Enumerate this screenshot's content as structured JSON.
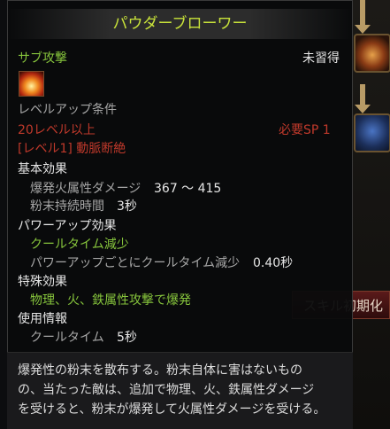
{
  "background": {
    "reset_button_label": "スキル初期化"
  },
  "tooltip": {
    "title": "パウダーブローワー",
    "skill_type": "サブ攻撃",
    "learn_status": "未習得",
    "level_up_header": "レベルアップ条件",
    "required_level": "20レベル以上",
    "required_sp": "必要SP 1",
    "prerequisite": "[レベル1] 動脈断絶",
    "basic_effect_header": "基本効果",
    "basic_effects": [
      {
        "name": "爆発火属性ダメージ",
        "value": "367 ～ 415"
      },
      {
        "name": "粉末持続時間",
        "value": "3秒"
      }
    ],
    "powerup_header": "パワーアップ効果",
    "powerup_name": "クールタイム減少",
    "powerup_effect": {
      "name": "パワーアップごとにクールタイム減少",
      "value": "0.40秒"
    },
    "special_header": "特殊効果",
    "special_effect": "物理、火、鉄属性攻撃で爆発",
    "usage_header": "使用情報",
    "cooldown": {
      "name": "クールタイム",
      "value": "5秒"
    },
    "description": [
      "爆発性の粉末を散布する。粉末自体に害はないもの",
      "の、当たった敵は、追加で物理、火、鉄属性ダメージ",
      "を受けると、粉末が爆発して火属性ダメージを受ける。"
    ]
  },
  "colors": {
    "title": "#c9e33a",
    "green": "#86c43c",
    "red": "#c0392b",
    "white": "#e6e6e6",
    "gray": "#a6a6a6"
  },
  "icons": [
    "fire-skill-icon",
    "skill-node-icon",
    "arrow-down-icon"
  ]
}
